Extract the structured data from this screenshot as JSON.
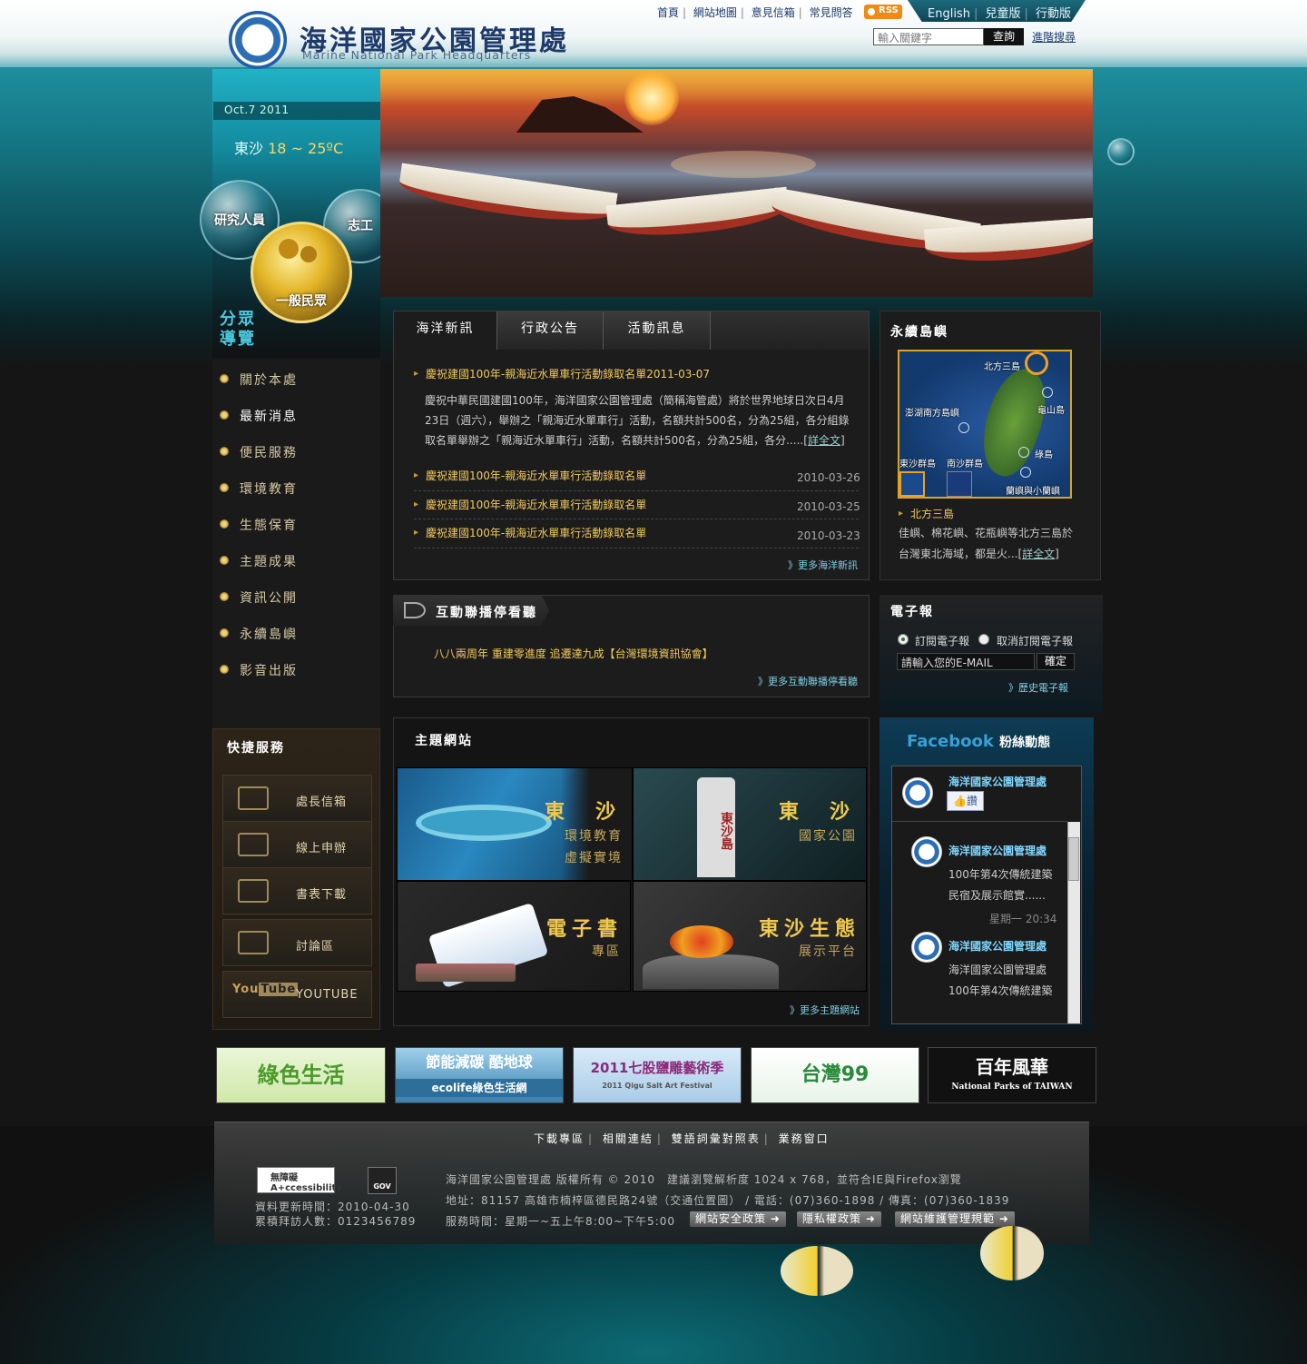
{
  "header": {
    "title": "海洋國家公園管理處",
    "subtitle": "Marine National Park Headquarters",
    "top_links": [
      "首頁",
      "網站地圖",
      "意見信箱",
      "常見問答"
    ],
    "rss": "RSS",
    "lang_links": [
      "English",
      "兒童版",
      "行動版"
    ],
    "search_placeholder": "輸入關鍵字",
    "search_button": "查詢",
    "advanced_search": "進階搜尋"
  },
  "sidebar": {
    "date": "Oct.7 2011",
    "weather_place": "東沙",
    "weather_temp": "18 ~ 25ºC",
    "audience": [
      "研究人員",
      "志工",
      "一般民眾"
    ],
    "guide_title": [
      "分眾",
      "導覽"
    ],
    "nav": [
      "關於本處",
      "最新消息",
      "便民服務",
      "環境教育",
      "生態保育",
      "主題成果",
      "資訊公開",
      "永續島嶼",
      "影音出版"
    ],
    "nav_active": "最新消息",
    "quick_title": "快捷服務",
    "quick_links": [
      "處長信箱",
      "線上申辦",
      "書表下載",
      "討論區",
      "YOUTUBE"
    ]
  },
  "news": {
    "tabs": [
      "海洋新訊",
      "行政公告",
      "活動訊息"
    ],
    "featured_title": "慶祝建國100年-親海近水單車行活動錄取名單2011-03-07",
    "featured_body": "慶祝中華民國建國100年，海洋國家公園管理處（簡稱海管處）將於世界地球日次日4月23日（週六），舉辦之「親海近水單車行」活動，名額共計500名，分為25組，各分組錄取名單舉辦之「親海近水單車行」活動，名額共計500名，分為25組，各分.....",
    "read_more": "詳全文",
    "items": [
      {
        "title": "慶祝建國100年-親海近水單車行活動錄取名單",
        "date": "2010-03-26"
      },
      {
        "title": "慶祝建國100年-親海近水單車行活動錄取名單",
        "date": "2010-03-25"
      },
      {
        "title": "慶祝建國100年-親海近水單車行活動錄取名單",
        "date": "2010-03-23"
      }
    ],
    "more": "》更多海洋新訊"
  },
  "interactive": {
    "title": "互動聯播停看聽",
    "item": "八八兩周年 重建零進度 追遷達九成【台灣環境資訊協會】",
    "more": "》更多互動聯播停看聽"
  },
  "themes": {
    "title": "主題網站",
    "tiles": [
      {
        "big": "東　沙",
        "small": [
          "環境教育",
          "虛擬實境"
        ]
      },
      {
        "big": "東　沙",
        "small": [
          "國家公園"
        ]
      },
      {
        "big": "電子書",
        "small": [
          "專區"
        ]
      },
      {
        "big": "東沙生態",
        "small": [
          "展示平台"
        ]
      }
    ],
    "stone_text": "東沙島",
    "more": "》更多主題網站"
  },
  "islands": {
    "title": "永續島嶼",
    "map_labels": [
      "北方三島",
      "澎湖南方島嶼",
      "龜山島",
      "綠島",
      "東沙群島",
      "南沙群島",
      "蘭嶼與小蘭嶼"
    ],
    "selected": "北方三島",
    "desc": "佳嶼、棉花嶼、花瓶嶼等北方三島於台灣東北海域，都是火...",
    "read_more": "詳全文"
  },
  "epaper": {
    "title": "電子報",
    "subscribe": "訂閱電子報",
    "unsubscribe": "取消訂閱電子報",
    "email_placeholder": "請輸入您的E-MAIL",
    "confirm": "確定",
    "history": "》歷史電子報"
  },
  "facebook": {
    "title": "Facebook",
    "subtitle": "粉絲動態",
    "page_name": "海洋國家公園管理處",
    "like": "讚",
    "posts": [
      {
        "name": "海洋國家公園管理處",
        "text": [
          "100年第4次傳統建築",
          "民宿及展示館實......"
        ],
        "time": "星期一 20:34"
      },
      {
        "name": "海洋國家公園管理處",
        "text": [
          "海洋國家公園管理處",
          "100年第4次傳統建築"
        ]
      }
    ]
  },
  "banners": [
    {
      "label": "綠色生活",
      "color": "#7cc242"
    },
    {
      "label": "節能減碳 酷地球",
      "sub": "ecolife綠色生活網",
      "color": "#2d7fb0"
    },
    {
      "label": "2011七股鹽雕藝術季",
      "sub": "2011 Qigu Salt Art Festival",
      "color": "#3a78b8"
    },
    {
      "label": "台灣99",
      "color": "#2a9a4a"
    },
    {
      "label": "百年風華",
      "sub": "National Parks of TAIWAN",
      "color": "#111111"
    }
  ],
  "footer": {
    "links": [
      "下載專區",
      "相關連結",
      "雙語詞彙對照表",
      "業務窗口"
    ],
    "accessibility": "無障礙 A+ccessibility",
    "gov": "GOV",
    "update_time": "資料更新時間：2010-04-30",
    "visits": "累積拜訪人數：0123456789",
    "copyright": "海洋國家公園管理處 版權所有 © 2010　建議瀏覽解析度 1024 x 768，並符合IE與Firefox瀏覽",
    "address": "地址：81157 高雄市楠梓區德民路24號（交通位置圖） / 電話：(07)360-1898 / 傳真：(07)360-1839",
    "hours": "服務時間：星期一~五上午8:00~下午5:00",
    "buttons": [
      "網站安全政策",
      "隱私權政策",
      "網站維護管理規範"
    ]
  }
}
